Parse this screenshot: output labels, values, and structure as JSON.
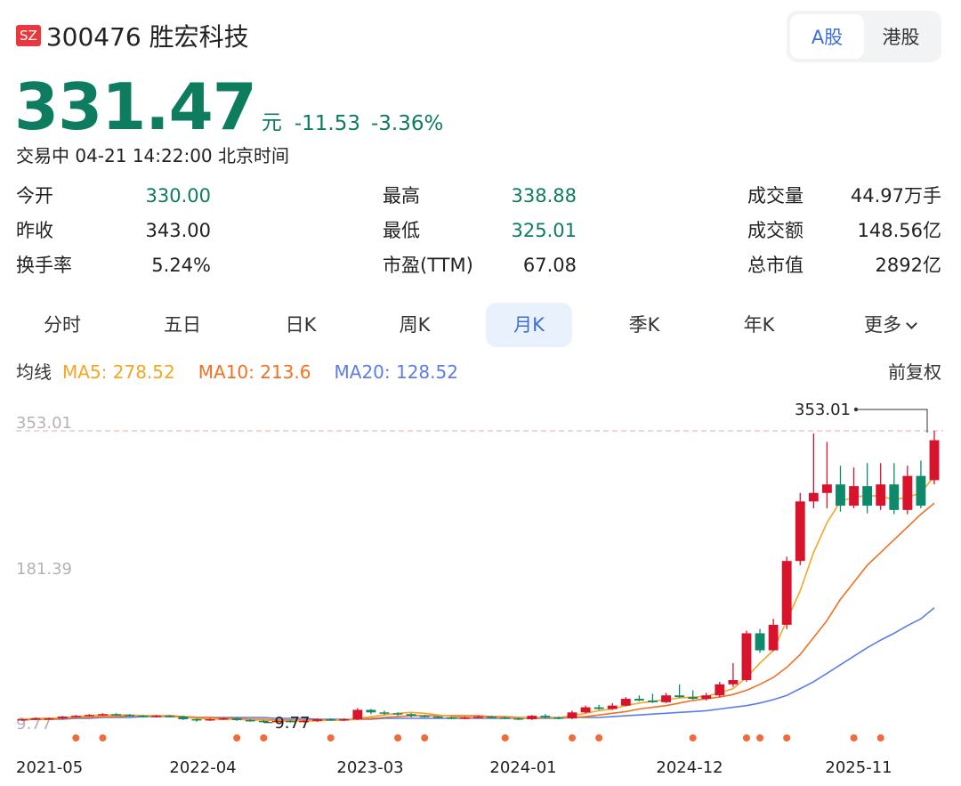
{
  "stock": {
    "market": "SZ",
    "title": "300476 胜宏科技"
  },
  "market_toggle": {
    "a_share": "A股",
    "hk_share": "港股"
  },
  "price": {
    "current": "331.47",
    "unit": "元",
    "change": "-11.53",
    "change_pct": "-3.36%"
  },
  "status": "交易中 04-21 14:22:00 北京时间",
  "stats": {
    "open_label": "今开",
    "open": "330.00",
    "prev_close_label": "昨收",
    "prev_close": "343.00",
    "turnover_rate_label": "换手率",
    "turnover_rate": "5.24%",
    "high_label": "最高",
    "high": "338.88",
    "low_label": "最低",
    "low": "325.01",
    "pe_label": "市盈(TTM)",
    "pe": "67.08",
    "volume_label": "成交量",
    "volume": "44.97万手",
    "amount_label": "成交额",
    "amount": "148.56亿",
    "mktcap_label": "总市值",
    "mktcap": "2892亿"
  },
  "tabs": [
    "分时",
    "五日",
    "日K",
    "周K",
    "月K",
    "季K",
    "年K",
    "更多"
  ],
  "active_tab": "月K",
  "ma": {
    "label": "均线",
    "ma5": "MA5: 278.52",
    "ma10": "MA10: 213.6",
    "ma20": "MA20: 128.52"
  },
  "adjust_label": "前复权",
  "colors": {
    "up": "#d8132b",
    "down": "#0e8a6a",
    "ma5": "#f5a623",
    "ma10": "#f07024",
    "ma20": "#5b7ee5",
    "price": "#0e7c5e",
    "marker": "#f06a3a"
  },
  "chart_data": {
    "type": "candlestick",
    "y_axis_labels": [
      "353.01",
      "181.39",
      "9.77"
    ],
    "ylim": [
      9.77,
      353.01
    ],
    "x_labels": [
      "2021-05",
      "2022-04",
      "2023-03",
      "2024-01",
      "2024-12",
      "2025-11"
    ],
    "max_annotation": "353.01",
    "min_annotation": "9.77",
    "reference_line": 353.01,
    "candles": [
      [
        13,
        14,
        12,
        15
      ],
      [
        14,
        15,
        13,
        16
      ],
      [
        15,
        15,
        14,
        16
      ],
      [
        15,
        17,
        14,
        18
      ],
      [
        17,
        18,
        16,
        19
      ],
      [
        18,
        19,
        17,
        20
      ],
      [
        19,
        20,
        18,
        21
      ],
      [
        20,
        19,
        18,
        21
      ],
      [
        19,
        18,
        17,
        20
      ],
      [
        18,
        17,
        16,
        19
      ],
      [
        17,
        18,
        16,
        19
      ],
      [
        18,
        17,
        16,
        19
      ],
      [
        17,
        14,
        13,
        18
      ],
      [
        14,
        13,
        11,
        15
      ],
      [
        13,
        14,
        12,
        15
      ],
      [
        14,
        15,
        13,
        16
      ],
      [
        15,
        13,
        12,
        16
      ],
      [
        13,
        12,
        11,
        14
      ],
      [
        12,
        11,
        10,
        13
      ],
      [
        11,
        12,
        10,
        13
      ],
      [
        12,
        11,
        10,
        13
      ],
      [
        11,
        12,
        10,
        13
      ],
      [
        12,
        14,
        11,
        15
      ],
      [
        14,
        13,
        12,
        15
      ],
      [
        13,
        14,
        12,
        15
      ],
      [
        14,
        25,
        13,
        27
      ],
      [
        25,
        22,
        20,
        26
      ],
      [
        22,
        21,
        19,
        24
      ],
      [
        21,
        20,
        18,
        22
      ],
      [
        20,
        18,
        16,
        21
      ],
      [
        18,
        17,
        16,
        19
      ],
      [
        17,
        16,
        15,
        18
      ],
      [
        16,
        15,
        14,
        17
      ],
      [
        15,
        16,
        14,
        17
      ],
      [
        16,
        17,
        15,
        18
      ],
      [
        17,
        16,
        15,
        18
      ],
      [
        16,
        15,
        14,
        17
      ],
      [
        15,
        14,
        13,
        16
      ],
      [
        14,
        18,
        13,
        19
      ],
      [
        18,
        16,
        15,
        20
      ],
      [
        16,
        15,
        14,
        17
      ],
      [
        15,
        22,
        14,
        24
      ],
      [
        22,
        28,
        21,
        30
      ],
      [
        28,
        26,
        25,
        31
      ],
      [
        26,
        30,
        25,
        33
      ],
      [
        30,
        38,
        29,
        40
      ],
      [
        38,
        36,
        35,
        42
      ],
      [
        36,
        34,
        33,
        44
      ],
      [
        34,
        42,
        33,
        45
      ],
      [
        42,
        40,
        39,
        55
      ],
      [
        40,
        38,
        37,
        48
      ],
      [
        38,
        42,
        36,
        45
      ],
      [
        42,
        55,
        40,
        58
      ],
      [
        55,
        60,
        52,
        80
      ],
      [
        60,
        115,
        58,
        118
      ],
      [
        115,
        95,
        92,
        120
      ],
      [
        95,
        125,
        94,
        132
      ],
      [
        125,
        200,
        120,
        205
      ],
      [
        200,
        270,
        195,
        280
      ],
      [
        270,
        280,
        262,
        350
      ],
      [
        280,
        290,
        262,
        340
      ],
      [
        290,
        265,
        258,
        312
      ],
      [
        265,
        288,
        262,
        310
      ],
      [
        288,
        265,
        256,
        315
      ],
      [
        265,
        290,
        260,
        315
      ],
      [
        290,
        260,
        255,
        315
      ],
      [
        260,
        300,
        255,
        312
      ],
      [
        300,
        265,
        262,
        318
      ],
      [
        295,
        342,
        290,
        353.01
      ]
    ],
    "ma5": [
      14,
      15,
      15,
      16,
      17,
      18,
      19,
      19,
      19,
      18,
      18,
      17,
      16,
      15,
      14,
      14,
      14,
      13,
      13,
      12,
      12,
      12,
      12,
      13,
      13,
      15,
      17,
      19,
      21,
      22,
      21,
      19,
      17,
      16,
      16,
      16,
      16,
      15,
      16,
      16,
      16,
      18,
      21,
      24,
      26,
      30,
      33,
      35,
      37,
      39,
      40,
      41,
      45,
      50,
      63,
      80,
      95,
      130,
      165,
      210,
      245,
      270,
      275,
      277,
      276,
      272,
      275,
      280,
      300
    ],
    "ma10": [
      14,
      14,
      14,
      15,
      16,
      16,
      17,
      17,
      18,
      18,
      18,
      18,
      17,
      16,
      16,
      15,
      15,
      14,
      14,
      13,
      13,
      13,
      13,
      13,
      13,
      14,
      15,
      16,
      17,
      18,
      18,
      18,
      18,
      18,
      18,
      17,
      17,
      16,
      16,
      16,
      16,
      16,
      17,
      19,
      21,
      23,
      26,
      28,
      30,
      33,
      36,
      38,
      40,
      43,
      48,
      55,
      63,
      75,
      90,
      110,
      130,
      155,
      175,
      195,
      210,
      225,
      240,
      255,
      268
    ],
    "ma20": [
      13,
      14,
      14,
      14,
      15,
      15,
      16,
      16,
      16,
      17,
      17,
      17,
      17,
      16,
      16,
      16,
      16,
      16,
      16,
      15,
      15,
      15,
      14,
      14,
      14,
      14,
      14,
      15,
      15,
      15,
      15,
      15,
      15,
      15,
      15,
      15,
      15,
      15,
      15,
      15,
      15,
      16,
      16,
      16,
      17,
      18,
      19,
      20,
      21,
      22,
      23,
      24,
      26,
      28,
      30,
      33,
      37,
      42,
      50,
      58,
      68,
      78,
      88,
      98,
      107,
      115,
      124,
      132,
      145
    ],
    "markers": [
      4,
      6,
      16,
      18,
      23,
      28,
      30,
      36,
      41,
      43,
      50,
      54,
      55,
      57,
      62,
      64
    ]
  }
}
